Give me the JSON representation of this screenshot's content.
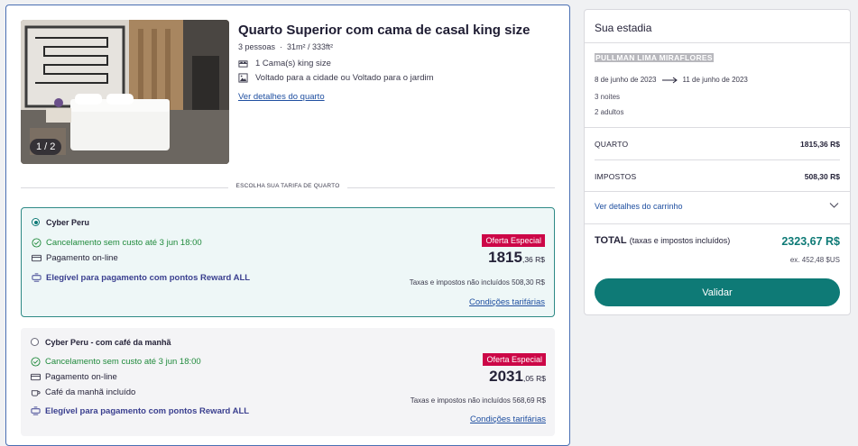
{
  "room": {
    "title": "Quarto Superior com cama de casal king size",
    "guests": "3 pessoas",
    "dot": "·",
    "size": "31m² / 333ft²",
    "features": [
      {
        "icon": "bed-icon",
        "label": "1 Cama(s) king size"
      },
      {
        "icon": "window-view-icon",
        "label": "Voltado para a cidade ou Voltado para o jardim"
      }
    ],
    "details_link": "Ver detalhes do quarto",
    "photo_counter": "1 / 2"
  },
  "rates_heading": "ESCOLHA SUA TARIFA DE QUARTO",
  "rates": [
    {
      "name": "Cyber Peru",
      "selected": true,
      "cancellation": "Cancelamento sem custo até 3 jun 18:00",
      "payment": "Pagamento on-line",
      "reward": "Elegível para pagamento com pontos Reward ALL",
      "badge": "Oferta Especial",
      "price_main": "1815",
      "price_cents": ",36 R$",
      "taxes": "Taxas e impostos não incluídos 508,30 R$",
      "conditions": "Condições tarifárias"
    },
    {
      "name": "Cyber Peru - com café da manhã",
      "selected": false,
      "cancellation": "Cancelamento sem custo até 3 jun 18:00",
      "payment": "Pagamento on-line",
      "breakfast": "Café da manhã incluído",
      "reward": "Elegível para pagamento com pontos Reward ALL",
      "badge": "Oferta Especial",
      "price_main": "2031",
      "price_cents": ",05 R$",
      "taxes": "Taxas e impostos não incluídos 568,69 R$",
      "conditions": "Condições tarifárias"
    }
  ],
  "stay": {
    "title": "Sua estadia",
    "hotel": "PULLMAN LIMA MIRAFLORES",
    "checkin": "8 de junho de 2023",
    "checkout": "11 de junho de 2023",
    "nights": "3 noites",
    "adults": "2 adultos",
    "room_label": "QUARTO",
    "room_price": "1815,36 R$",
    "taxes_label": "IMPOSTOS",
    "taxes_price": "508,30 R$",
    "cart_link": "Ver detalhes do carrinho",
    "total_label": "TOTAL",
    "total_note": "(taxas e impostos incluídos)",
    "total_value": "2323,67 R$",
    "usd": "ex. 452,48 $US",
    "validate": "Validar"
  },
  "colors": {
    "accent": "#0e7a76",
    "badge": "#cc0747",
    "link": "#1f4fa0",
    "positive": "#208a3c",
    "reward": "#3a3f8f"
  }
}
